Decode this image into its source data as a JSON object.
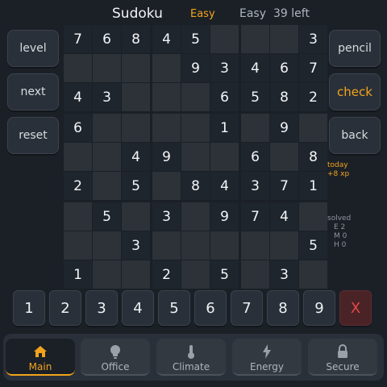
{
  "header": {
    "title": "Sudoku",
    "difficulty": "Easy",
    "mode": "Easy",
    "remaining": "39 left"
  },
  "left_buttons": {
    "level": "level",
    "next": "next",
    "reset": "reset"
  },
  "right_buttons": {
    "pencil": "pencil",
    "check": "check",
    "back": "back"
  },
  "stats": {
    "today_label": "today",
    "today_xp": "+8 xp",
    "solved_label": "solved",
    "easy": "E 2",
    "medium": "M 0",
    "hard": "H 0"
  },
  "grid": [
    [
      "7",
      "6",
      "8",
      "4",
      "5",
      "",
      "",
      "",
      "3"
    ],
    [
      "",
      "",
      "",
      "",
      "9",
      "3",
      "4",
      "6",
      "7"
    ],
    [
      "4",
      "3",
      "",
      "",
      "",
      "6",
      "5",
      "8",
      "2"
    ],
    [
      "6",
      "",
      "",
      "",
      "",
      "1",
      "",
      "9",
      ""
    ],
    [
      "",
      "",
      "4",
      "9",
      "",
      "",
      "6",
      "",
      "8"
    ],
    [
      "2",
      "",
      "5",
      "",
      "8",
      "4",
      "3",
      "7",
      "1"
    ],
    [
      "",
      "5",
      "",
      "3",
      "",
      "9",
      "7",
      "4",
      ""
    ],
    [
      "",
      "",
      "3",
      "",
      "",
      "",
      "",
      "",
      "5"
    ],
    [
      "1",
      "",
      "",
      "2",
      "",
      "5",
      "",
      "3",
      ""
    ]
  ],
  "numpad": {
    "keys": [
      "1",
      "2",
      "3",
      "4",
      "5",
      "6",
      "7",
      "8",
      "9"
    ],
    "clear": "X"
  },
  "nav": {
    "tabs": [
      {
        "label": "Main",
        "icon": "home-icon",
        "active": true
      },
      {
        "label": "Office",
        "icon": "lightbulb-icon",
        "active": false
      },
      {
        "label": "Climate",
        "icon": "thermometer-icon",
        "active": false
      },
      {
        "label": "Energy",
        "icon": "lightning-icon",
        "active": false
      },
      {
        "label": "Secure",
        "icon": "lock-icon",
        "active": false
      }
    ]
  },
  "colors": {
    "accent": "#f2a31c",
    "clear": "#e34848",
    "background": "#1b2027"
  }
}
